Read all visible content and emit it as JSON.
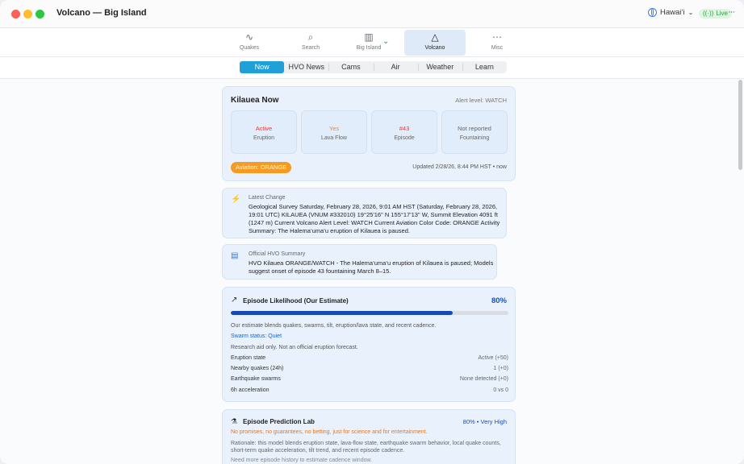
{
  "window": {
    "title": "Volcano — Big Island"
  },
  "titlebar": {
    "region": "Hawai‘i",
    "live_label": "Live",
    "more": "···"
  },
  "toolbar": {
    "items": [
      {
        "label": "Quakes",
        "icon": "pulse-icon",
        "glyph": "∿"
      },
      {
        "label": "Search",
        "icon": "magnifier-icon",
        "glyph": "⌕"
      },
      {
        "label": "Big Island",
        "icon": "map-icon",
        "glyph": "▥"
      },
      {
        "label": "Volcano",
        "icon": "volcano-icon",
        "glyph": "△"
      },
      {
        "label": "Misc",
        "icon": "ellipsis-circle-icon",
        "glyph": "⋯"
      }
    ],
    "chevron": "⌄"
  },
  "tabs": [
    "Now",
    "HVO News",
    "Cams",
    "Air",
    "Weather",
    "Learn"
  ],
  "now_card": {
    "title": "Kilauea Now",
    "alert": "Alert level: WATCH",
    "tiles": [
      {
        "value": "Active",
        "label": "Eruption",
        "color": "#e53935"
      },
      {
        "value": "Yes",
        "label": "Lava Flow",
        "color": "#ef8a1e"
      },
      {
        "value": "#43",
        "label": "Episode",
        "color": "#e53935"
      },
      {
        "value": "Not reported",
        "label": "Fountaining",
        "color": "#666666"
      }
    ],
    "aviation": "Aviation: ORANGE",
    "updated": "Updated 2/28/26, 8:44 PM HST • now"
  },
  "latest": {
    "tag": "Latest Change",
    "lines": [
      "Geological Survey Saturday, February 28, 2026, 9:01 AM HST (Saturday, February 28, 2026,",
      "19:01 UTC) KILAUEA (VNUM #332010) 19°25'16\" N 155°17'13\" W, Summit Elevation 4091 ft",
      "(1247 m) Current Volcano Alert Level: WATCH Current Aviation Color Code: ORANGE Activity",
      "Summary: The Halema‘uma‘u eruption of Kilauea is paused."
    ]
  },
  "summary": {
    "tag": "Official HVO Summary",
    "lines": [
      "HVO Kilauea ORANGE/WATCH - The Halema‘uma‘u eruption of Kilauea is paused; Models",
      "suggest onset of episode 43 fountaining March 8–15."
    ]
  },
  "likelihood": {
    "title": "Episode Likelihood (Our Estimate)",
    "percent_label": "80%",
    "fraction": 0.8,
    "note": "Our estimate blends quakes, swarms, tilt, eruption/lava state, and recent cadence.",
    "swarm": "Swarm status: Quiet",
    "disclaimer": "Research aid only. Not an official eruption forecast.",
    "rows": [
      {
        "k": "Eruption state",
        "v": "Active (+50)"
      },
      {
        "k": "Nearby quakes (24h)",
        "v": "1 (+0)"
      },
      {
        "k": "Earthquake swarms",
        "v": "None detected (+0)"
      },
      {
        "k": "6h acceleration",
        "v": "0 vs 0"
      }
    ]
  },
  "lab": {
    "title": "Episode Prediction Lab",
    "badge": "80% • Very High",
    "warning": "No promises, no guarantees, no betting, just for science and for entertainment.",
    "rationale": [
      "Rationale: this model blends eruption state, lava-flow state, earthquake swarm behavior, local quake counts,",
      "short-term quake acceleration, tilt trend, and recent episode cadence."
    ],
    "need": "Need more episode history to estimate cadence window."
  }
}
